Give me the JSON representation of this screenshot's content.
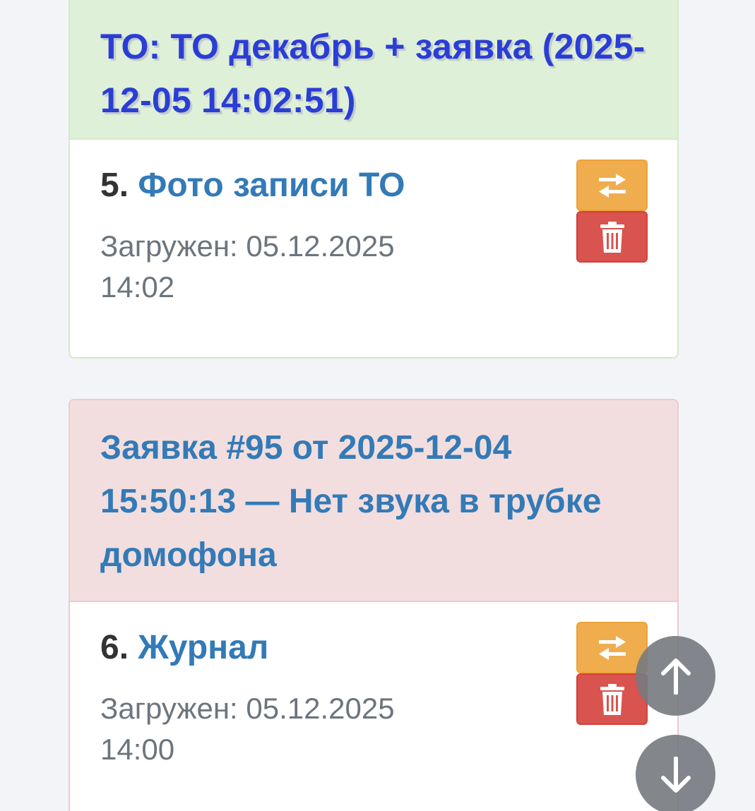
{
  "groups": [
    {
      "header": "ТО: ТО декабрь + заявка (2025-12-05 14:02:51)",
      "item": {
        "number": "5.",
        "title": "Фото записи ТО",
        "uploaded_label": "Загружен: 05.12.2025",
        "uploaded_time": "14:02"
      },
      "status_color": "#dff0d8"
    },
    {
      "header": "Заявка #95 от 2025-12-04 15:50:13 — Нет звука в трубке домофона",
      "item": {
        "number": "6.",
        "title": "Журнал",
        "uploaded_label": "Загружен: 05.12.2025",
        "uploaded_time": "14:00"
      },
      "status_color": "#f2dede"
    }
  ],
  "icons": {
    "swap": "swap-arrows-icon",
    "delete": "trash-icon",
    "scroll_up": "arrow-up-icon",
    "scroll_down": "arrow-down-icon"
  },
  "colors": {
    "swap_button": "#f0ad4e",
    "delete_button": "#d9534f",
    "link": "#337ab7",
    "to_header_text": "#2a3ed6"
  }
}
